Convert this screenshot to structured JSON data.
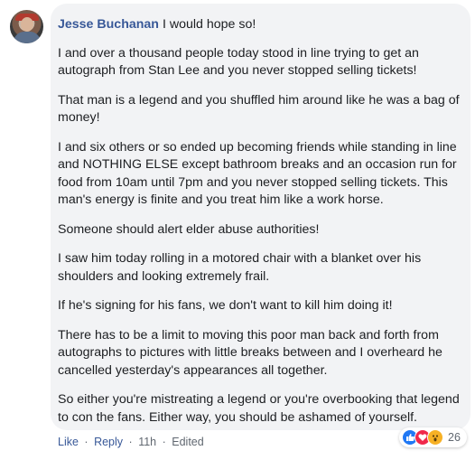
{
  "comment": {
    "author": "Jesse Buchanan",
    "first_line": "I would hope so!",
    "paragraphs": [
      "I and over a thousand people today stood in line trying to get an autograph from Stan Lee and you never stopped selling tickets!",
      "That man is a legend and you shuffled him around like he was a bag of money!",
      "I and six others or so ended up becoming friends while standing in line and NOTHING ELSE except bathroom breaks and an occasion run for food from 10am until 7pm and you never stopped selling tickets. This man's energy is finite and you treat him like a work horse.",
      "Someone should alert elder abuse authorities!",
      "I saw him today rolling in a motored chair with a blanket over his shoulders and looking extremely frail.",
      "If he's signing for his fans, we don't want to kill him doing it!",
      "There has to be a limit to moving this poor man back and forth from autographs to pictures with little breaks between and I overheard he cancelled yesterday's appearances all together.",
      "So either you're mistreating a legend or you're overbooking that legend to con the fans. Either way, you should be ashamed of yourself."
    ]
  },
  "actions": {
    "like": "Like",
    "reply": "Reply",
    "time": "11h",
    "edited": "Edited",
    "separator": "·"
  },
  "reactions": {
    "icons": [
      "like-icon",
      "love-icon",
      "wow-icon"
    ],
    "count": "26"
  },
  "colors": {
    "bubble": "#f2f3f5",
    "author": "#385898",
    "text": "#1c1e21",
    "meta": "#606770"
  }
}
